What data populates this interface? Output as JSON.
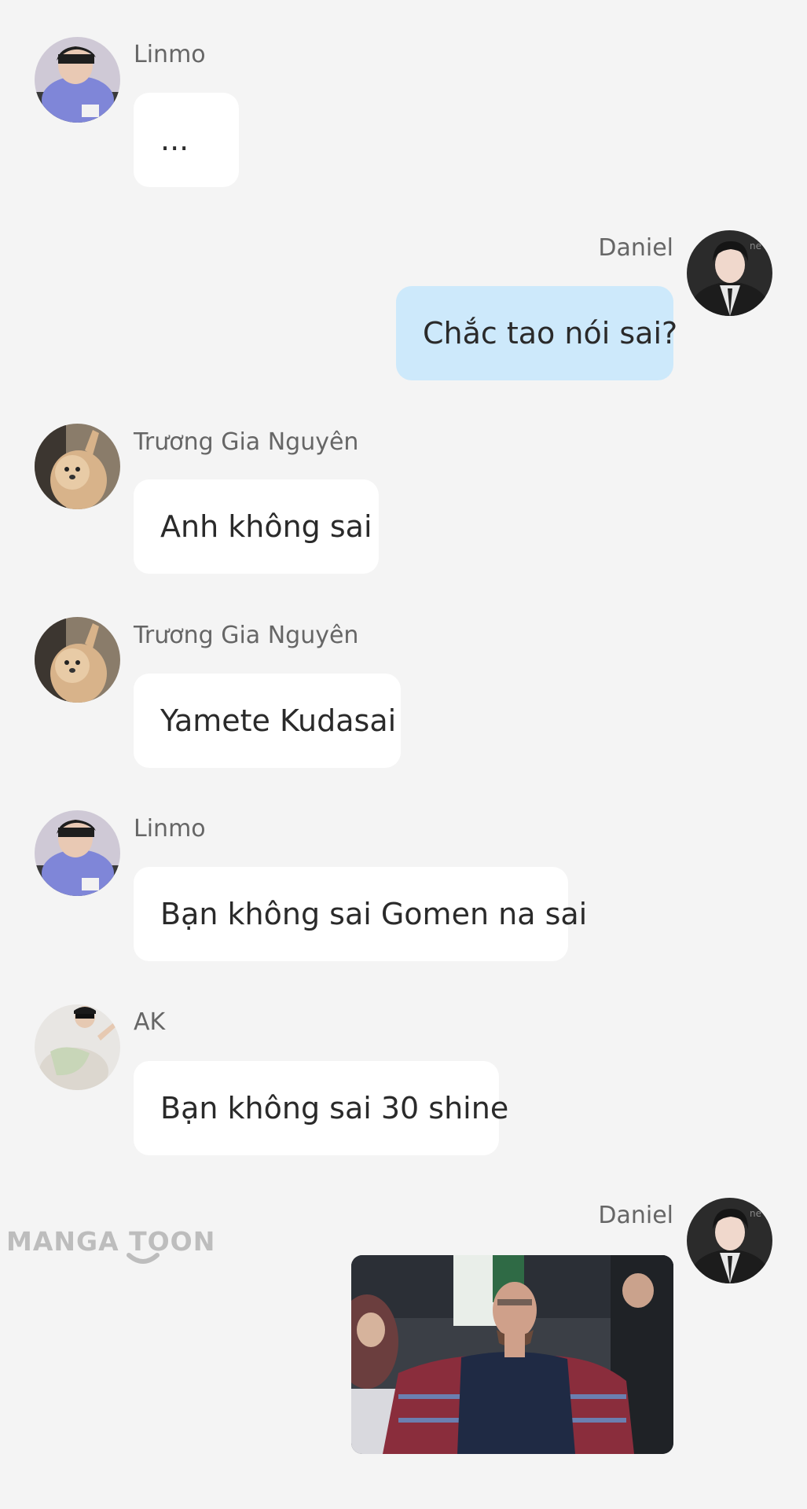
{
  "messages": [
    {
      "sender": "Linmo",
      "side": "left",
      "text": "...",
      "avatar": "avatar-linmo"
    },
    {
      "sender": "Daniel",
      "side": "right",
      "text": "Chắc tao nói sai?",
      "avatar": "avatar-daniel"
    },
    {
      "sender": "Trương Gia Nguyên",
      "side": "left",
      "text": "Anh không sai",
      "avatar": "avatar-dog"
    },
    {
      "sender": "Trương Gia Nguyên",
      "side": "left",
      "text": "Yamete Kudasai",
      "avatar": "avatar-dog"
    },
    {
      "sender": "Linmo",
      "side": "left",
      "text": "Bạn không sai Gomen na sai",
      "avatar": "avatar-linmo"
    },
    {
      "sender": "AK",
      "side": "left",
      "text": "Bạn không sai 30 shine",
      "avatar": "avatar-ak"
    },
    {
      "sender": "Daniel",
      "side": "right",
      "image": "meme-photo-unimpressed-man",
      "avatar": "avatar-daniel"
    }
  ],
  "watermark": {
    "text": "MANGA TOON"
  },
  "colors": {
    "background": "#f4f4f4",
    "bubble_other": "#ffffff",
    "bubble_mine": "#cde9fb",
    "sender_name": "#666666",
    "watermark": "#bdbdbd"
  }
}
